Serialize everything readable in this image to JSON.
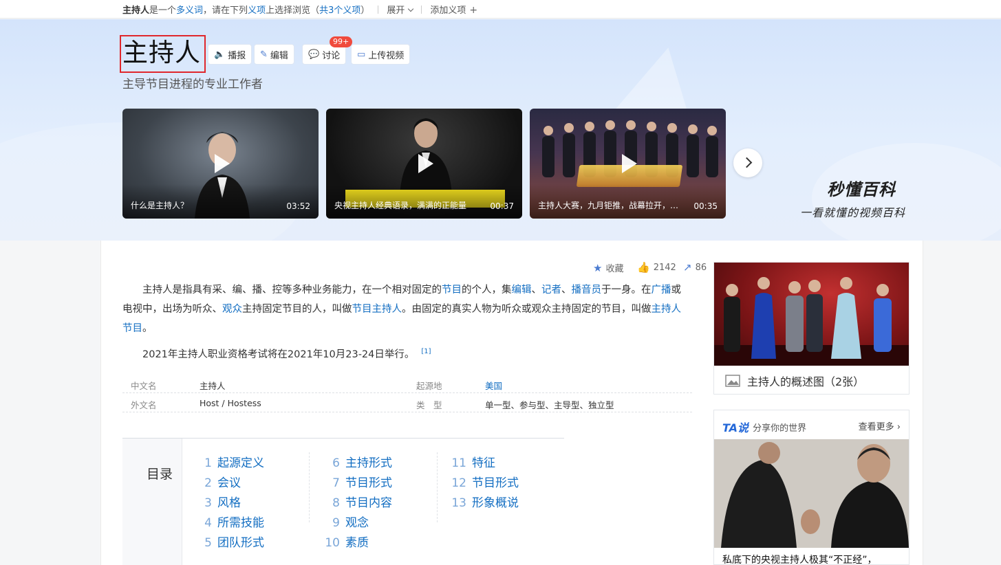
{
  "topbar": {
    "name": "主持人",
    "text1": "是一个",
    "link1": "多义词",
    "text2": "，请在下列",
    "link2": "义项",
    "text3": "上选择浏览（",
    "link3": "共3个义项",
    "text4": "）",
    "expand": "展开",
    "add_sense": "添加义项"
  },
  "hero": {
    "title": "主持人",
    "subtitle": "主导节目进程的专业工作者",
    "buttons": {
      "broadcast": "播报",
      "edit": "编辑",
      "discuss": "讨论",
      "upload": "上传视频"
    },
    "discuss_badge": "99+",
    "videos": [
      {
        "caption": "什么是主持人？",
        "duration": "03:52"
      },
      {
        "caption": "央视主持人经典语录，满满的正能量",
        "duration": "00:37"
      },
      {
        "caption": "主持人大赛，九月钜推，战幕拉开，…",
        "duration": "00:35"
      }
    ],
    "brand": "秒懂百科",
    "brand_slogan": "一看就懂的视频百科"
  },
  "meta": {
    "collect": "收藏",
    "likes": "2142",
    "shares": "86"
  },
  "intro": {
    "p1_a": "主持人是指具有采、编、播、控等多种业务能力，在一个相对固定的",
    "p1_link1": "节目",
    "p1_b": "的个人，集",
    "p1_link2": "编辑",
    "p1_c": "、",
    "p1_link3": "记者",
    "p1_d": "、",
    "p1_link4": "播音员",
    "p1_e": "于一身。在",
    "p1_link5": "广播",
    "p1_f": "或电视中，出场为听众、",
    "p1_link6": "观众",
    "p1_g": "主持固定节目的人，叫做",
    "p1_link7": "节目主持人",
    "p1_h": "。由固定的真实人物为听众或观众主持固定的节目，叫做",
    "p1_link8": "主持人节目",
    "p1_i": "。",
    "p2": "2021年主持人职业资格考试将在2021年10月23-24日举行。",
    "p2_ref": "[1]"
  },
  "basic_info": [
    {
      "k1": "中文名",
      "v1": "主持人",
      "k2": "起源地",
      "v2": "美国"
    },
    {
      "k1": "外文名",
      "v1": "Host / Hostess",
      "k2": "类　型",
      "v2": "单一型、参与型、主导型、独立型"
    }
  ],
  "toc": {
    "heading": "目录",
    "items": [
      {
        "n": "1",
        "t": "起源定义"
      },
      {
        "n": "2",
        "t": "会议"
      },
      {
        "n": "3",
        "t": "风格"
      },
      {
        "n": "4",
        "t": "所需技能"
      },
      {
        "n": "5",
        "t": "团队形式"
      },
      {
        "n": "6",
        "t": "主持形式"
      },
      {
        "n": "7",
        "t": "节目形式"
      },
      {
        "n": "8",
        "t": "节目内容"
      },
      {
        "n": "9",
        "t": "观念"
      },
      {
        "n": "10",
        "t": "素质"
      },
      {
        "n": "11",
        "t": "特征"
      },
      {
        "n": "12",
        "t": "节目形式"
      },
      {
        "n": "13",
        "t": "形象概说"
      }
    ]
  },
  "side": {
    "overview_caption": "主持人的概述图（2张）",
    "ta_logo": "TA说",
    "ta_slogan": "分享你的世界",
    "ta_more": "查看更多",
    "ta_caption": "私底下的央视主持人极其“不正经”，"
  },
  "colors": {
    "link": "#136ec2",
    "badge": "#f04a3c",
    "highlight_box": "#e0262b",
    "hero_bg": "#dce8fc"
  }
}
